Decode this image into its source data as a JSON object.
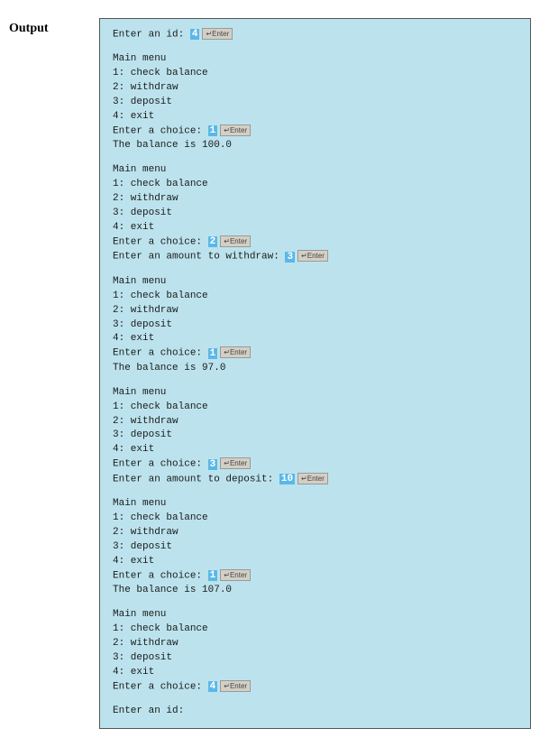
{
  "label": "Output",
  "enterKeyLabel": "↵Enter",
  "menu": {
    "title": "Main menu",
    "opt1": "1: check balance",
    "opt2": "2: withdraw",
    "opt3": "3: deposit",
    "opt4": "4: exit"
  },
  "prompts": {
    "enterId": "Enter an id: ",
    "enterChoice": "Enter a choice: ",
    "withdrawAmt": "Enter an amount to withdraw: ",
    "depositAmt": "Enter an amount to deposit: ",
    "balancePrefix": "The balance is "
  },
  "session": {
    "idInput": "4",
    "step1": {
      "choice": "1",
      "balance": "100.0"
    },
    "step2": {
      "choice": "2",
      "amount": "3"
    },
    "step3": {
      "choice": "1",
      "balance": "97.0"
    },
    "step4": {
      "choice": "3",
      "amount": "10"
    },
    "step5": {
      "choice": "1",
      "balance": "107.0"
    },
    "step6": {
      "choice": "4"
    }
  }
}
